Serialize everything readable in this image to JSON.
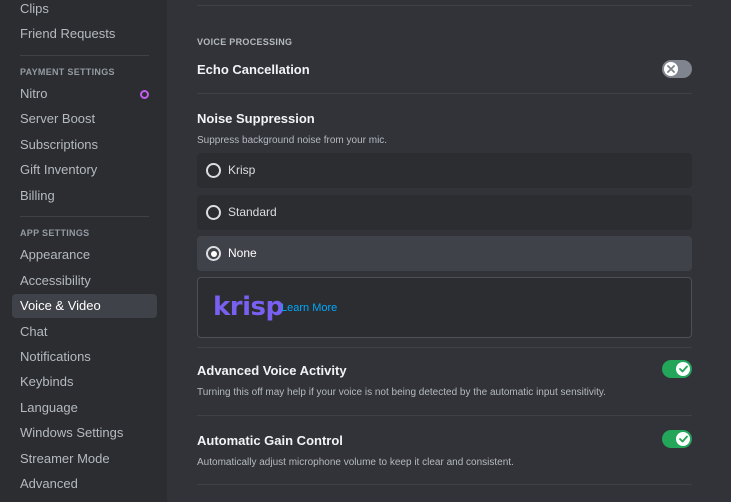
{
  "sidebar": {
    "items_top": [
      {
        "label": "Clips"
      },
      {
        "label": "Friend Requests"
      }
    ],
    "payment_header": "PAYMENT SETTINGS",
    "payment_items": [
      {
        "label": "Nitro"
      },
      {
        "label": "Server Boost"
      },
      {
        "label": "Subscriptions"
      },
      {
        "label": "Gift Inventory"
      },
      {
        "label": "Billing"
      }
    ],
    "app_header": "APP SETTINGS",
    "app_items": [
      {
        "label": "Appearance"
      },
      {
        "label": "Accessibility"
      },
      {
        "label": "Voice & Video"
      },
      {
        "label": "Chat"
      },
      {
        "label": "Notifications"
      },
      {
        "label": "Keybinds"
      },
      {
        "label": "Language"
      },
      {
        "label": "Windows Settings"
      },
      {
        "label": "Streamer Mode"
      },
      {
        "label": "Advanced"
      }
    ],
    "active_item": "Voice & Video"
  },
  "content": {
    "section_header": "VOICE PROCESSING",
    "echo": {
      "title": "Echo Cancellation",
      "enabled": false
    },
    "noise": {
      "title": "Noise Suppression",
      "description": "Suppress background noise from your mic.",
      "options": [
        {
          "label": "Krisp",
          "selected": false
        },
        {
          "label": "Standard",
          "selected": false
        },
        {
          "label": "None",
          "selected": true
        }
      ]
    },
    "krisp": {
      "logo_text": "krisp",
      "link": "Learn More"
    },
    "advanced_voice": {
      "title": "Advanced Voice Activity",
      "description": "Turning this off may help if your voice is not being detected by the automatic input sensitivity.",
      "enabled": true
    },
    "agc": {
      "title": "Automatic Gain Control",
      "description": "Automatically adjust microphone volume to keep it clear and consistent.",
      "enabled": true
    }
  },
  "colors": {
    "background": "#313338",
    "sidebar": "#2b2d31",
    "toggle_on": "#23a55a",
    "toggle_off": "#80848e",
    "krisp_brand": "#7a60f0",
    "link": "#00a8fc",
    "nitro_badge": "#c45df0"
  }
}
